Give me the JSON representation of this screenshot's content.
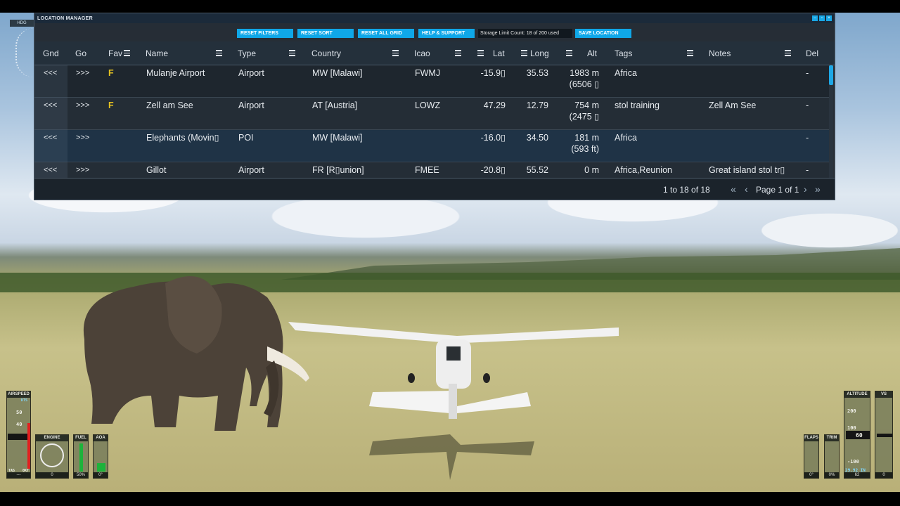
{
  "window": {
    "title": "LOCATION MANAGER",
    "controls": [
      "–",
      "▫",
      "×"
    ]
  },
  "toolbar": {
    "reset_filters": "RESET FILTERS",
    "reset_sort": "RESET SORT",
    "reset_all_grid": "RESET ALL GRID",
    "help_support": "HELP & SUPPORT",
    "storage_status": "Storage Limit Count: 18 of 200 used",
    "save_location": "SAVE LOCATION"
  },
  "grid": {
    "columns": [
      "Gnd",
      "Go",
      "Fav",
      "Name",
      "Type",
      "Country",
      "Icao",
      "Lat",
      "Long",
      "Alt",
      "Tags",
      "Notes",
      "Del"
    ],
    "rows": [
      {
        "gnd": "<<<",
        "go": ">>>",
        "fav": "F",
        "name": "Mulanje Airport",
        "type": "Airport",
        "country": "MW [Malawi]",
        "icao": "FWMJ",
        "lat": "-15.9▯",
        "long": "35.53",
        "alt": "1983 m",
        "alt2": "(6506 ▯",
        "tags": "Africa",
        "notes": "",
        "del": "-"
      },
      {
        "gnd": "<<<",
        "go": ">>>",
        "fav": "F",
        "name": "Zell am See",
        "type": "Airport",
        "country": "AT [Austria]",
        "icao": "LOWZ",
        "lat": "47.29",
        "long": "12.79",
        "alt": "754 m",
        "alt2": "(2475 ▯",
        "tags": "stol training",
        "notes": "Zell Am See",
        "del": "-"
      },
      {
        "gnd": "<<<",
        "go": ">>>",
        "fav": "",
        "name": "Elephants (Movin▯",
        "type": "POI",
        "country": "MW [Malawi]",
        "icao": "",
        "lat": "-16.0▯",
        "long": "34.50",
        "alt": "181 m",
        "alt2": "(593 ft)",
        "tags": "Africa",
        "notes": "",
        "del": "-"
      },
      {
        "gnd": "<<<",
        "go": ">>>",
        "fav": "",
        "name": "Gillot",
        "type": "Airport",
        "country": "FR [R▯union]",
        "icao": "FMEE",
        "lat": "-20.8▯",
        "long": "55.52",
        "alt": "0 m",
        "alt2": "",
        "tags": "Africa,Reunion",
        "notes": "Great island stol tr▯",
        "del": "-"
      }
    ]
  },
  "pager": {
    "count": "1 to 18 of 18",
    "page": "Page 1 of 1",
    "first": "«",
    "prev": "‹",
    "next": "›",
    "last": "»"
  },
  "hud": {
    "heading_label": "HDG",
    "airspeed": {
      "label": "AIRSPEED",
      "unit": "KTS",
      "t50": "50",
      "t40": "40",
      "tas": "TAS",
      "kt": "0KT",
      "val": "---"
    },
    "engine": {
      "label": "ENGINE",
      "val": "0"
    },
    "fuel": {
      "label": "FUEL",
      "val": "50%"
    },
    "aoa": {
      "label": "AOA",
      "val": "0°"
    },
    "flaps": {
      "label": "FLAPS",
      "val": "0°"
    },
    "trim": {
      "label": "TRIM",
      "val": "0%"
    },
    "altitude": {
      "label": "ALTITUDE",
      "t200": "200",
      "t100": "100",
      "cur": "60",
      "tm100": "-100",
      "baro": "29.92 IN",
      "val": "62"
    },
    "vs": {
      "label": "VS",
      "val": "0"
    }
  },
  "colors": {
    "accent": "#0fa7e8",
    "fav": "#e7c420",
    "window_bg": "#1e262e"
  }
}
